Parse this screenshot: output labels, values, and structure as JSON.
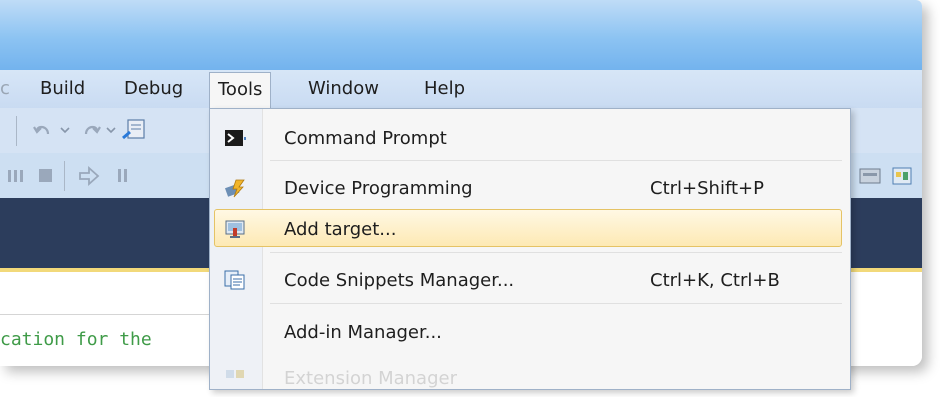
{
  "menubar": {
    "items": [
      "Build",
      "Debug",
      "Tools",
      "Window",
      "Help"
    ]
  },
  "code_line": "cation for the",
  "tools_menu": {
    "items": [
      {
        "label": "Command Prompt",
        "shortcut": "",
        "icon": "command-prompt-icon"
      },
      {
        "label": "Device Programming",
        "shortcut": "Ctrl+Shift+P",
        "icon": "device-programming-icon"
      },
      {
        "label": "Add target...",
        "shortcut": "",
        "icon": "add-target-icon",
        "highlighted": true
      },
      {
        "label": "Code Snippets Manager...",
        "shortcut": "Ctrl+K, Ctrl+B",
        "icon": "code-snippets-icon"
      },
      {
        "label": "Add-in Manager...",
        "shortcut": "",
        "icon": ""
      },
      {
        "label": "Extension Manager",
        "shortcut": "",
        "icon": "extension-manager-icon",
        "disabled": true
      }
    ]
  },
  "colors": {
    "highlight": "#fde9b4",
    "code_green": "#3f9b48",
    "dark_band": "#2c3d5c"
  }
}
